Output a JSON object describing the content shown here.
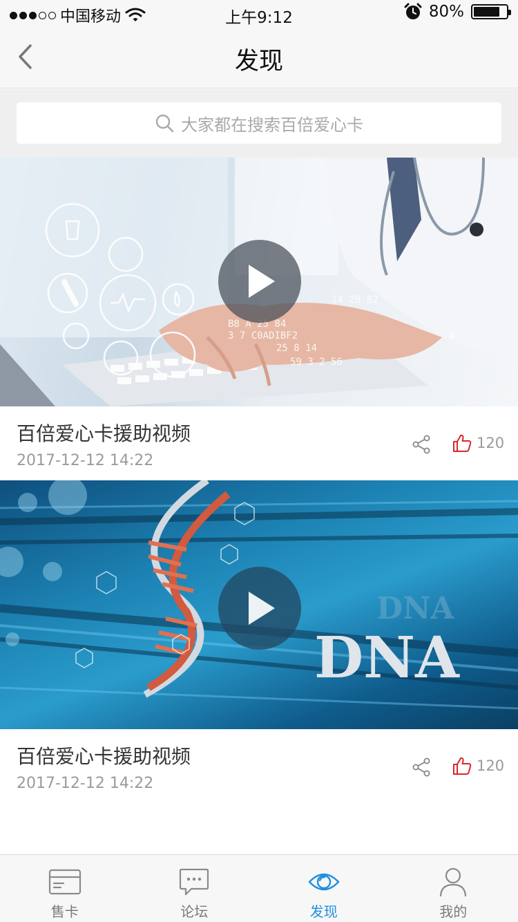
{
  "status_bar": {
    "signal_filled": 3,
    "signal_total": 5,
    "carrier": "中国移动",
    "time": "上午9:12",
    "battery_percent": "80%",
    "battery_level": 0.8
  },
  "nav": {
    "title": "发现"
  },
  "search": {
    "placeholder": "大家都在搜索百倍爱心卡"
  },
  "videos": [
    {
      "title": "百倍爱心卡援助视频",
      "date": "2017-12-12 14:22",
      "likes": "120"
    },
    {
      "title": "百倍爱心卡援助视频",
      "date": "2017-12-12 14:22",
      "likes": "120",
      "cover_text": "DNA"
    }
  ],
  "tabs": [
    {
      "label": "售卡",
      "icon": "card-icon"
    },
    {
      "label": "论坛",
      "icon": "chat-bubble-icon"
    },
    {
      "label": "发现",
      "icon": "eye-icon",
      "active": true
    },
    {
      "label": "我的",
      "icon": "user-icon"
    }
  ],
  "colors": {
    "accent": "#1f8fe0",
    "like": "#d9262b",
    "muted_text": "#9a9a9a",
    "background": "#efefef"
  }
}
